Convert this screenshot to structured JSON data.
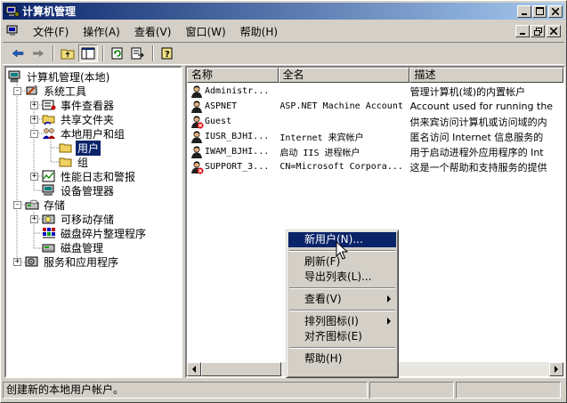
{
  "window": {
    "title": "计算机管理"
  },
  "menu": [
    {
      "label": "文件(F)"
    },
    {
      "label": "操作(A)"
    },
    {
      "label": "查看(V)"
    },
    {
      "label": "窗口(W)"
    },
    {
      "label": "帮助(H)"
    }
  ],
  "tree": [
    {
      "label": "计算机管理(本地)",
      "icon": "computer-icon",
      "expander": "",
      "level": 0
    },
    {
      "label": "系统工具",
      "icon": "tools-icon",
      "expander": "-",
      "level": 1
    },
    {
      "label": "事件查看器",
      "icon": "event-viewer-icon",
      "expander": "+",
      "level": 2
    },
    {
      "label": "共享文件夹",
      "icon": "shared-folder-icon",
      "expander": "+",
      "level": 2
    },
    {
      "label": "本地用户和组",
      "icon": "users-groups-icon",
      "expander": "-",
      "level": 2
    },
    {
      "label": "用户",
      "icon": "folder-icon",
      "expander": "",
      "level": 3,
      "selected": true
    },
    {
      "label": "组",
      "icon": "folder-icon",
      "expander": "",
      "level": 3
    },
    {
      "label": "性能日志和警报",
      "icon": "performance-icon",
      "expander": "+",
      "level": 2
    },
    {
      "label": "设备管理器",
      "icon": "device-manager-icon",
      "expander": "",
      "level": 2
    },
    {
      "label": "存储",
      "icon": "storage-icon",
      "expander": "-",
      "level": 1
    },
    {
      "label": "可移动存储",
      "icon": "removable-storage-icon",
      "expander": "+",
      "level": 2
    },
    {
      "label": "磁盘碎片整理程序",
      "icon": "defrag-icon",
      "expander": "",
      "level": 2
    },
    {
      "label": "磁盘管理",
      "icon": "disk-management-icon",
      "expander": "",
      "level": 2
    },
    {
      "label": "服务和应用程序",
      "icon": "services-icon",
      "expander": "+",
      "level": 1
    }
  ],
  "list": {
    "columns": [
      "名称",
      "全名",
      "描述"
    ],
    "rows": [
      {
        "name": "Administr...",
        "full_name": "",
        "description": "管理计算机(域)的内置帐户",
        "disabled": false
      },
      {
        "name": "ASPNET",
        "full_name": "ASP.NET Machine Account",
        "description": "Account used for running the",
        "disabled": false
      },
      {
        "name": "Guest",
        "full_name": "",
        "description": "供来宾访问计算机或访问域的内",
        "disabled": true
      },
      {
        "name": "IUSR_BJHI...",
        "full_name": "Internet 来宾帐户",
        "description": "匿名访问 Internet 信息服务的",
        "disabled": false
      },
      {
        "name": "IWAM_BJHI...",
        "full_name": "启动 IIS 进程帐户",
        "description": "用于启动进程外应用程序的 Int",
        "disabled": false
      },
      {
        "name": "SUPPORT_3...",
        "full_name": "CN=Microsoft Corpora...",
        "description": "这是一个帮助和支持服务的提供",
        "disabled": true
      }
    ]
  },
  "context_menu": {
    "items": [
      {
        "label": "新用户(N)...",
        "highlight": true,
        "submenu": false
      },
      {
        "sep": true
      },
      {
        "label": "刷新(F)",
        "submenu": false
      },
      {
        "label": "导出列表(L)...",
        "submenu": false
      },
      {
        "sep": true
      },
      {
        "label": "查看(V)",
        "submenu": true
      },
      {
        "sep": true
      },
      {
        "label": "排列图标(I)",
        "submenu": true
      },
      {
        "label": "对齐图标(E)",
        "submenu": false
      },
      {
        "sep": true
      },
      {
        "label": "帮助(H)",
        "submenu": false
      }
    ]
  },
  "status": {
    "text": "创建新的本地用户帐户。"
  }
}
